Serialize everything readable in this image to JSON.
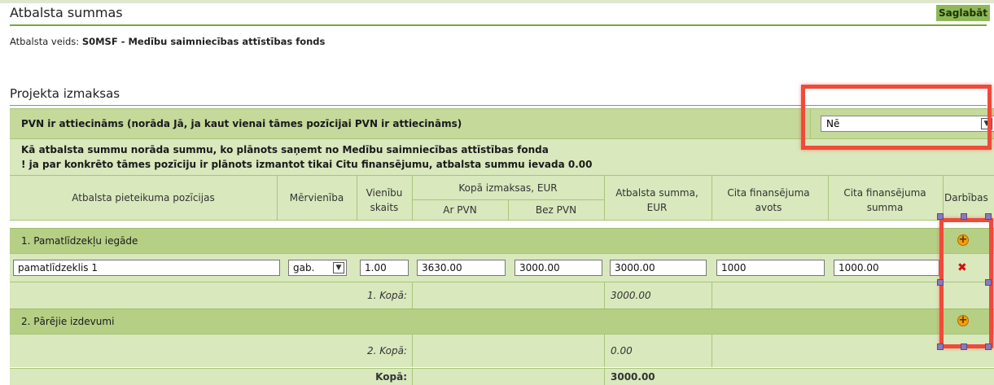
{
  "header": {
    "title": "Atbalsta summas",
    "save_label": "Saglabāt"
  },
  "support_type": {
    "prefix": "Atbalsta veids:",
    "code": "S0MSF",
    "separator": " - ",
    "name": "Medību saimniecības attīstības fonds"
  },
  "section": {
    "title": "Projekta izmaksas"
  },
  "pvn": {
    "label": "PVN ir attiecināms (norāda Jā, ja kaut vienai tāmes pozīcijai PVN ir attiecināms)",
    "selected": "Nē"
  },
  "note": {
    "line1": "Kā atbalsta summu norāda summu, ko plānots saņemt no Medību saimniecības attīstības fonda",
    "line2": "! ja par konkrēto tāmes pozīciju ir plānots izmantot tikai Citu finansējumu, atbalsta summu ievada 0.00"
  },
  "table": {
    "headers": {
      "position": "Atbalsta pieteikuma pozīcijas",
      "unit": "Mērvienība",
      "qty": "Vienību skaits",
      "total_costs": "Kopā izmaksas, EUR",
      "with_vat": "Ar PVN",
      "without_vat": "Bez PVN",
      "support_sum": "Atbalsta summa, EUR",
      "other_source": "Cita finansējuma avots",
      "other_sum": "Cita finansējuma summa",
      "actions": "Darbības"
    },
    "groups": [
      {
        "label": "1. Pamatlīdzekļu iegāde",
        "items": [
          {
            "name": "pamatlīdzeklis 1",
            "unit": "gab.",
            "qty": "1.00",
            "with_vat": "3630.00",
            "without_vat": "3000.00",
            "support_sum": "3000.00",
            "other_source": "1000",
            "other_sum": "1000.00"
          }
        ],
        "total_label": "1. Kopā:",
        "total_value": "3000.00"
      },
      {
        "label": "2. Pārējie izdevumi",
        "items": [],
        "total_label": "2. Kopā:",
        "total_value": "0.00"
      }
    ],
    "grand_total_label": "Kopā:",
    "grand_total_value": "3000.00"
  },
  "icons": {
    "add": "plus-circle-icon",
    "remove": "remove-x-icon",
    "dropdown": "chevron-down-icon"
  },
  "colors": {
    "accent_green": "#8fb85a",
    "highlight": "#f04a3a",
    "add": "#f2a10c",
    "remove": "#d01010"
  }
}
